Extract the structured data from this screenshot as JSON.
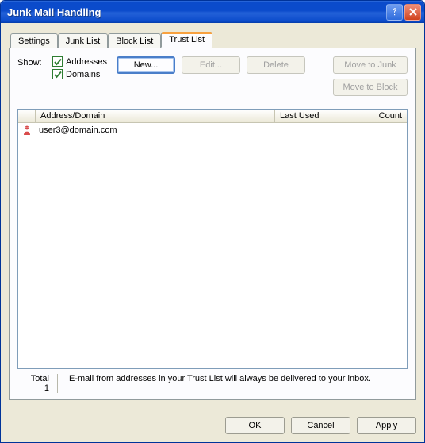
{
  "window": {
    "title": "Junk Mail Handling"
  },
  "tabs": [
    {
      "label": "Settings"
    },
    {
      "label": "Junk List"
    },
    {
      "label": "Block List"
    },
    {
      "label": "Trust List"
    }
  ],
  "active_tab_index": 3,
  "panel": {
    "show_label": "Show:",
    "checkboxes": {
      "addresses": {
        "label": "Addresses",
        "checked": true
      },
      "domains": {
        "label": "Domains",
        "checked": true
      }
    },
    "buttons": {
      "new": "New...",
      "edit": "Edit...",
      "delete": "Delete",
      "move_junk": "Move to Junk",
      "move_block": "Move to Block"
    },
    "columns": {
      "address": "Address/Domain",
      "last_used": "Last Used",
      "count": "Count"
    },
    "rows": [
      {
        "address": "user3@domain.com",
        "last_used": "",
        "count": ""
      }
    ],
    "footer": {
      "total_label": "Total",
      "total_value": "1",
      "hint": "E-mail from addresses in your Trust List will always be delivered to your inbox."
    }
  },
  "dialog_buttons": {
    "ok": "OK",
    "cancel": "Cancel",
    "apply": "Apply"
  }
}
